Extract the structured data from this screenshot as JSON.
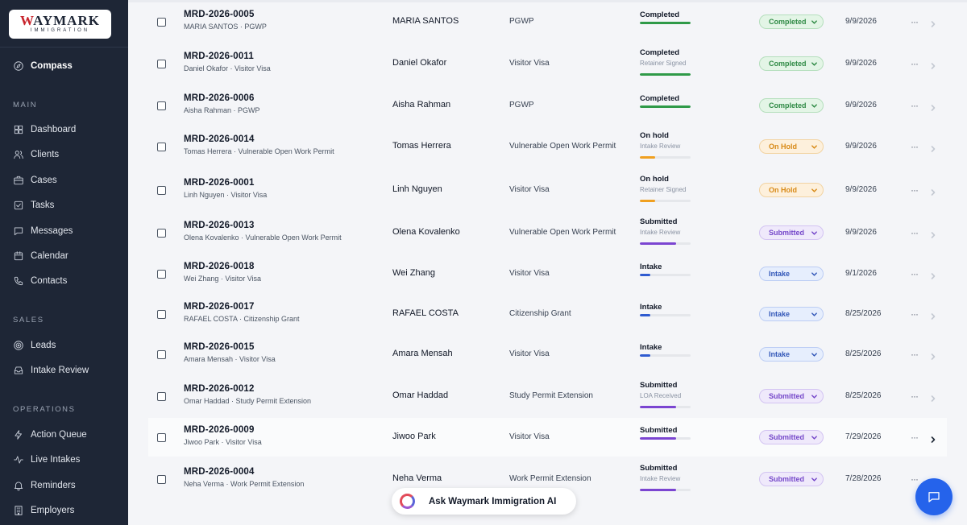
{
  "brand": {
    "logo_main_w": "W",
    "logo_main_rest": "AYMARK",
    "logo_sub": "IMMIGRATION"
  },
  "sidebar": {
    "compass": "Compass",
    "sections": {
      "main": "MAIN",
      "sales": "SALES",
      "operations": "OPERATIONS"
    },
    "main_items": [
      {
        "label": "Dashboard",
        "icon": "grid-icon"
      },
      {
        "label": "Clients",
        "icon": "users-icon"
      },
      {
        "label": "Cases",
        "icon": "briefcase-icon"
      },
      {
        "label": "Tasks",
        "icon": "checkbox-icon"
      },
      {
        "label": "Messages",
        "icon": "message-icon"
      },
      {
        "label": "Calendar",
        "icon": "calendar-icon"
      },
      {
        "label": "Contacts",
        "icon": "phone-icon"
      }
    ],
    "sales_items": [
      {
        "label": "Leads",
        "icon": "target-icon"
      },
      {
        "label": "Intake Review",
        "icon": "inbox-icon"
      }
    ],
    "operations_items": [
      {
        "label": "Action Queue",
        "icon": "zap-icon"
      },
      {
        "label": "Live Intakes",
        "icon": "activity-icon"
      },
      {
        "label": "Reminders",
        "icon": "bell-icon"
      },
      {
        "label": "Employers",
        "icon": "building-icon"
      }
    ]
  },
  "colors": {
    "completed": {
      "bg": "#e3f5e6",
      "border": "#b5dfbd",
      "text": "#2f8a45",
      "bar": "#2f9a48"
    },
    "on_hold": {
      "bg": "#fdf0dc",
      "border": "#f2d3a2",
      "text": "#d88a17",
      "bar": "#f0a020"
    },
    "submitted": {
      "bg": "#efe9fb",
      "border": "#d3c4f2",
      "text": "#7446c9",
      "bar": "#7b45d1"
    },
    "intake": {
      "bg": "#e6eefd",
      "border": "#bccdf4",
      "text": "#3257b8",
      "bar": "#2f5bd0"
    }
  },
  "rows": [
    {
      "id": "MRD-2026-0005",
      "sub": "MARIA SANTOS · PGWP",
      "name": "MARIA SANTOS",
      "type": "PGWP",
      "stage": "Completed",
      "stage_sub": "",
      "progress": 1.0,
      "status": "Completed",
      "status_key": "completed",
      "date": "9/9/2026"
    },
    {
      "id": "MRD-2026-0011",
      "sub": "Daniel Okafor · Visitor Visa",
      "name": "Daniel Okafor",
      "type": "Visitor Visa",
      "stage": "Completed",
      "stage_sub": "Retainer Signed",
      "progress": 1.0,
      "status": "Completed",
      "status_key": "completed",
      "date": "9/9/2026"
    },
    {
      "id": "MRD-2026-0006",
      "sub": "Aisha Rahman · PGWP",
      "name": "Aisha Rahman",
      "type": "PGWP",
      "stage": "Completed",
      "stage_sub": "",
      "progress": 1.0,
      "status": "Completed",
      "status_key": "completed",
      "date": "9/9/2026"
    },
    {
      "id": "MRD-2026-0014",
      "sub": "Tomas Herrera · Vulnerable Open Work Permit",
      "name": "Tomas Herrera",
      "type": "Vulnerable Open Work Permit",
      "stage": "On hold",
      "stage_sub": "Intake Review",
      "progress": 0.3,
      "status": "On Hold",
      "status_key": "on_hold",
      "date": "9/9/2026"
    },
    {
      "id": "MRD-2026-0001",
      "sub": "Linh Nguyen · Visitor Visa",
      "name": "Linh Nguyen",
      "type": "Visitor Visa",
      "stage": "On hold",
      "stage_sub": "Retainer Signed",
      "progress": 0.3,
      "status": "On Hold",
      "status_key": "on_hold",
      "date": "9/9/2026"
    },
    {
      "id": "MRD-2026-0013",
      "sub": "Olena Kovalenko · Vulnerable Open Work Permit",
      "name": "Olena Kovalenko",
      "type": "Vulnerable Open Work Permit",
      "stage": "Submitted",
      "stage_sub": "Intake Review",
      "progress": 0.72,
      "status": "Submitted",
      "status_key": "submitted",
      "date": "9/9/2026"
    },
    {
      "id": "MRD-2026-0018",
      "sub": "Wei Zhang · Visitor Visa",
      "name": "Wei Zhang",
      "type": "Visitor Visa",
      "stage": "Intake",
      "stage_sub": "",
      "progress": 0.2,
      "status": "Intake",
      "status_key": "intake",
      "date": "9/1/2026"
    },
    {
      "id": "MRD-2026-0017",
      "sub": "RAFAEL COSTA · Citizenship Grant",
      "name": "RAFAEL COSTA",
      "type": "Citizenship Grant",
      "stage": "Intake",
      "stage_sub": "",
      "progress": 0.2,
      "status": "Intake",
      "status_key": "intake",
      "date": "8/25/2026"
    },
    {
      "id": "MRD-2026-0015",
      "sub": "Amara Mensah · Visitor Visa",
      "name": "Amara Mensah",
      "type": "Visitor Visa",
      "stage": "Intake",
      "stage_sub": "",
      "progress": 0.2,
      "status": "Intake",
      "status_key": "intake",
      "date": "8/25/2026"
    },
    {
      "id": "MRD-2026-0012",
      "sub": "Omar Haddad · Study Permit Extension",
      "name": "Omar Haddad",
      "type": "Study Permit Extension",
      "stage": "Submitted",
      "stage_sub": "LOA Received",
      "progress": 0.72,
      "status": "Submitted",
      "status_key": "submitted",
      "date": "8/25/2026"
    },
    {
      "id": "MRD-2026-0009",
      "sub": "Jiwoo Park · Visitor Visa",
      "name": "Jiwoo Park",
      "type": "Visitor Visa",
      "stage": "Submitted",
      "stage_sub": "",
      "progress": 0.72,
      "status": "Submitted",
      "status_key": "submitted",
      "date": "7/29/2026"
    },
    {
      "id": "MRD-2026-0004",
      "sub": "Neha Verma · Work Permit Extension",
      "name": "Neha Verma",
      "type": "Work Permit Extension",
      "stage": "Submitted",
      "stage_sub": "Intake Review",
      "progress": 0.72,
      "status": "Submitted",
      "status_key": "submitted",
      "date": "7/28/2026"
    }
  ],
  "row_actions": {
    "more": "···"
  },
  "assistant": {
    "label": "Ask Waymark Immigration AI"
  }
}
